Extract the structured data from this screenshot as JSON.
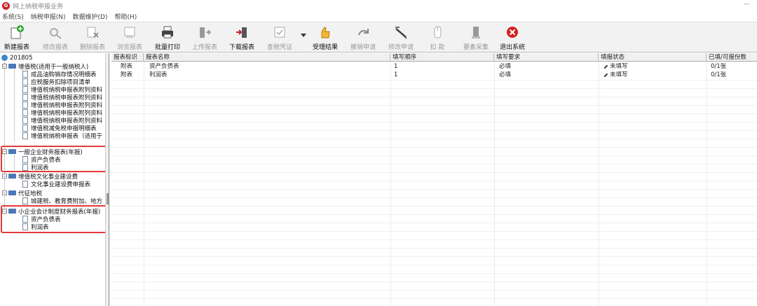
{
  "window": {
    "title": "网上纳税申报业务"
  },
  "menu": [
    "系统(S)",
    "纳税申报(N)",
    "数据维护(D)",
    "帮助(H)"
  ],
  "toolbar": {
    "buttons": [
      {
        "label": "新建报表",
        "icon": "new-report-icon",
        "enabled": true
      },
      {
        "label": "修改报表",
        "icon": "edit-report-icon",
        "enabled": false
      },
      {
        "label": "删除报表",
        "icon": "delete-report-icon",
        "enabled": false
      },
      {
        "label": "浏览报表",
        "icon": "browse-report-icon",
        "enabled": false
      },
      {
        "label": "批量打印",
        "icon": "print-icon",
        "enabled": true
      },
      {
        "label": "上传报表",
        "icon": "upload-icon",
        "enabled": false
      },
      {
        "label": "下载报表",
        "icon": "download-icon",
        "enabled": true
      },
      {
        "label": "查税凭证",
        "icon": "tax-voucher-icon",
        "enabled": false
      },
      {
        "label": "受理结果",
        "icon": "accept-result-icon",
        "enabled": true
      },
      {
        "label": "撤销申请",
        "icon": "undo-apply-icon",
        "enabled": false
      },
      {
        "label": "修改申请",
        "icon": "modify-apply-icon",
        "enabled": false
      },
      {
        "label": "扣  款",
        "icon": "deduct-icon",
        "enabled": false
      },
      {
        "label": "要素采集",
        "icon": "collect-icon",
        "enabled": false
      },
      {
        "label": "退出系统",
        "icon": "exit-icon",
        "enabled": true
      }
    ]
  },
  "tree": {
    "root": "201805",
    "nodes": [
      {
        "label": "增值税(适用于一般纳税人)",
        "level": 1,
        "type": "folder"
      },
      {
        "label": "成品油购销存情况明细表",
        "level": 2,
        "type": "doc"
      },
      {
        "label": "应税服务扣除项目清单",
        "level": 2,
        "type": "doc"
      },
      {
        "label": "增值税纳税申报表附列资料",
        "level": 2,
        "type": "doc"
      },
      {
        "label": "增值税纳税申报表附列资料",
        "level": 2,
        "type": "doc"
      },
      {
        "label": "增值税纳税申报表附列资料",
        "level": 2,
        "type": "doc"
      },
      {
        "label": "增值税纳税申报表附列资料",
        "level": 2,
        "type": "doc"
      },
      {
        "label": "增值税纳税申报表附列资料",
        "level": 2,
        "type": "doc"
      },
      {
        "label": "增值税减免税申报明细表",
        "level": 2,
        "type": "doc"
      },
      {
        "label": "增值税纳税申报表（适用于",
        "level": 2,
        "type": "doc"
      },
      {
        "label": "一般企业财务报表(年报)",
        "level": 1,
        "type": "folder"
      },
      {
        "label": "资产负债表",
        "level": 2,
        "type": "doc"
      },
      {
        "label": "利润表",
        "level": 2,
        "type": "doc"
      },
      {
        "label": "增值税文化事业建设费",
        "level": 1,
        "type": "folder"
      },
      {
        "label": "文化事业建设费申报表",
        "level": 2,
        "type": "doc"
      },
      {
        "label": "代征地税",
        "level": 1,
        "type": "folder"
      },
      {
        "label": "城建税、教育费附加、地方",
        "level": 2,
        "type": "doc"
      },
      {
        "label": "小企业会计制度财务报表(年报)",
        "level": 1,
        "type": "folder"
      },
      {
        "label": "资产负债表",
        "level": 2,
        "type": "doc"
      },
      {
        "label": "利润表",
        "level": 2,
        "type": "doc"
      }
    ]
  },
  "grid": {
    "columns": [
      "报表标识",
      "报表名称",
      "填写顺序",
      "填写要求",
      "填报状态",
      "已填/可报份数"
    ],
    "rows": [
      [
        "附表",
        "资产负债表",
        "1",
        "必填",
        "未填写",
        "0/1张"
      ],
      [
        "附表",
        "利润表",
        "1",
        "必填",
        "未填写",
        "0/1张"
      ]
    ]
  },
  "colors": {
    "accent_red": "#e23a3a",
    "folder_blue": "#4a78b8",
    "exit_red": "#d42020",
    "new_green": "#2aa52a"
  }
}
